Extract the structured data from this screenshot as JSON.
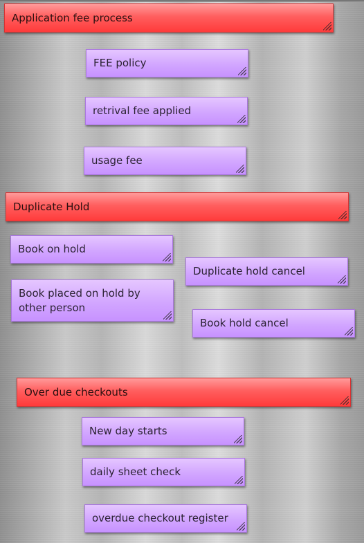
{
  "sections": [
    {
      "title": "Application fee process",
      "cards": [
        "FEE policy",
        "retrival fee applied",
        "usage fee"
      ]
    },
    {
      "title": "Duplicate Hold",
      "cards": [
        "Book on hold",
        "Book placed on hold by other person",
        "Duplicate hold cancel",
        "Book hold cancel"
      ]
    },
    {
      "title": "Over due checkouts",
      "cards": [
        "New day starts",
        "daily sheet check",
        "overdue checkout register"
      ]
    }
  ],
  "colors": {
    "header": "#ff4d4d",
    "note": "#d2a6ff"
  },
  "icons": {
    "resize": "resize-grip-icon"
  }
}
